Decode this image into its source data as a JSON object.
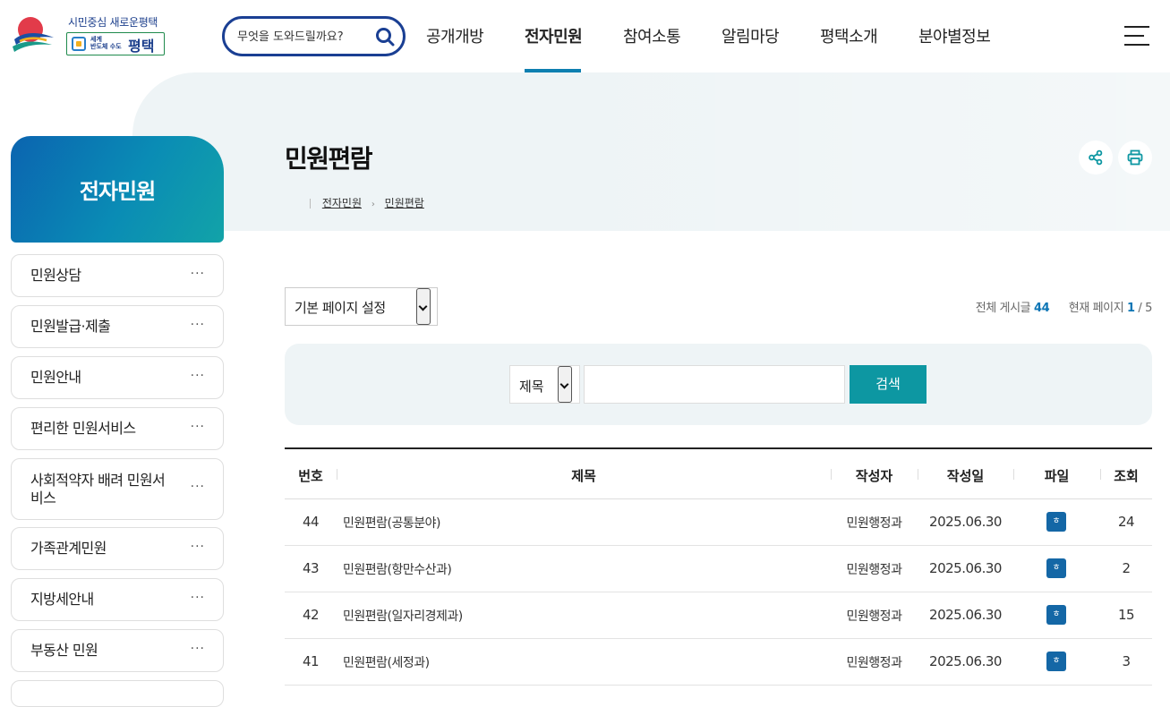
{
  "header": {
    "logo_slogan": "시민중심 새로운평택",
    "logo_sub_line1": "세계",
    "logo_sub_line2": "반도체 수도",
    "logo_city": "평택",
    "search_placeholder": "무엇을 도와드릴까요?",
    "gnb": [
      {
        "label": "공개개방",
        "active": false
      },
      {
        "label": "전자민원",
        "active": true
      },
      {
        "label": "참여소통",
        "active": false
      },
      {
        "label": "알림마당",
        "active": false
      },
      {
        "label": "평택소개",
        "active": false
      },
      {
        "label": "분야별정보",
        "active": false
      }
    ]
  },
  "sidebar": {
    "title": "전자민원",
    "more_glyph": "···",
    "items": [
      {
        "label": "민원상담"
      },
      {
        "label": "민원발급·제출"
      },
      {
        "label": "민원안내"
      },
      {
        "label": "편리한 민원서비스"
      },
      {
        "label": "사회적약자 배려 민원서비스"
      },
      {
        "label": "가족관계민원"
      },
      {
        "label": "지방세안내"
      },
      {
        "label": "부동산 민원"
      }
    ]
  },
  "page": {
    "title": "민원편람",
    "breadcrumb": [
      "전자민원",
      "민원편람"
    ],
    "breadcrumb_sep": "›"
  },
  "list_controls": {
    "page_select_value": "기본 페이지 설정",
    "total_label": "전체 게시글",
    "total_count": "44",
    "page_label": "현재 페이지",
    "current_page": "1",
    "page_sep": "/ 5"
  },
  "search": {
    "field_value": "제목",
    "keyword_value": "",
    "button_label": "검색"
  },
  "table": {
    "columns": [
      "번호",
      "제목",
      "작성자",
      "작성일",
      "파일",
      "조회"
    ],
    "file_icon_glyph": "ㅎ",
    "rows": [
      {
        "no": "44",
        "title": "민원편람(공통분야)",
        "writer": "민원행정과",
        "date": "2025.06.30",
        "views": "24"
      },
      {
        "no": "43",
        "title": "민원편람(항만수산과)",
        "writer": "민원행정과",
        "date": "2025.06.30",
        "views": "2"
      },
      {
        "no": "42",
        "title": "민원편람(일자리경제과)",
        "writer": "민원행정과",
        "date": "2025.06.30",
        "views": "15"
      },
      {
        "no": "41",
        "title": "민원편람(세정과)",
        "writer": "민원행정과",
        "date": "2025.06.30",
        "views": "3"
      }
    ]
  },
  "colors": {
    "brand_navy": "#1a3f93",
    "accent_teal": "#0d97a2",
    "accent_blue": "#0d7fb0",
    "panel_bg": "#eef4f6"
  }
}
